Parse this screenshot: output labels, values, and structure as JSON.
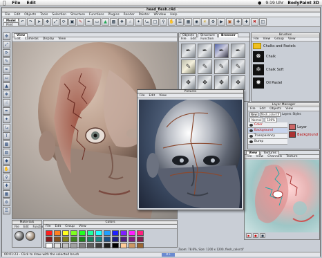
{
  "menubar": {
    "items": [
      "File",
      "Edit"
    ],
    "time": "9:19 Uhr",
    "app": "BodyPaint 3D"
  },
  "main_window": {
    "title": "head_flesh.c4d",
    "menu": [
      "File",
      "Edit",
      "Objects",
      "Tools",
      "Selection",
      "Structure",
      "Functions",
      "Plugins",
      "Render",
      "Painter",
      "Window",
      "Help"
    ],
    "mode_tabs": [
      "Model",
      "Paint"
    ],
    "toolbar_icons": [
      "undo-icon",
      "redo-icon",
      "arrow-icon",
      "move-icon",
      "scale-icon",
      "rotate-icon",
      "select-icon",
      "brush-icon",
      "pen-icon",
      "eraser-icon",
      "fill-icon",
      "gradient-icon",
      "clone-icon",
      "smudge-icon",
      "wand-icon",
      "lasso-icon",
      "rect-select-icon",
      "magnify-icon",
      "hand-icon",
      "layers-icon",
      "grid-icon",
      "camera-icon",
      "light-icon",
      "render-icon",
      "render-view-icon",
      "texture-icon",
      "uv-icon",
      "axis-icon",
      "paint-icon",
      "projection-icon"
    ]
  },
  "viewport": {
    "tab": "View",
    "menu": [
      "Edit",
      "Cameras",
      "Display",
      "View"
    ],
    "tools": [
      "move-icon",
      "scale-icon",
      "rotate-icon",
      "brush-icon",
      "pen-icon",
      "eraser-icon",
      "fill-icon",
      "clone-icon",
      "smudge-icon",
      "eyedrop-icon",
      "wand-icon",
      "lasso-icon",
      "text-icon",
      "stamp-icon",
      "gradient-icon",
      "shape-icon",
      "hand-icon",
      "zoom-icon"
    ]
  },
  "brushes": {
    "tabs": [
      "Objects",
      "Structure",
      "Browser"
    ],
    "menu": [
      "File",
      "Edit",
      "Function"
    ],
    "active_tab": "Browser"
  },
  "brushes_presets": {
    "title": "Brushes",
    "menu": [
      "File",
      "View",
      "Group",
      "View"
    ],
    "items": [
      "Chalks and Pastels",
      "Chalk",
      "Chalk Soft",
      "Oil Pastel"
    ]
  },
  "pictures_window": {
    "title": "Pictures",
    "menu": [
      "File",
      "Edit",
      "View"
    ]
  },
  "layer_manager": {
    "title": "Layer Manager",
    "menu": [
      "File",
      "Edit",
      "Objects",
      "View"
    ],
    "row1": [
      "New",
      "flesh_color.tif",
      "Layers",
      "Styles"
    ],
    "row2": [
      "Normal",
      "100%"
    ],
    "layers": [
      "Color",
      "Background",
      "Transparency",
      "Bump",
      "Layer",
      "Background"
    ]
  },
  "texture_view": {
    "title": "Texture View",
    "menu": [
      "File",
      "View",
      "Channels",
      "Texture",
      "Edit"
    ],
    "tab": "View",
    "tab2": "Textures",
    "status": "Zoom: 78.6%, Size: 1200 x 1200, flesh_color.tif"
  },
  "materials": {
    "title": "Materials",
    "menu": [
      "File",
      "Edit",
      "Function"
    ]
  },
  "colors": {
    "title": "Colors",
    "menu": [
      "File",
      "Edit",
      "Group",
      "View"
    ],
    "swatches": [
      "#ff1f1f",
      "#ff7f1f",
      "#ffff1f",
      "#7fff1f",
      "#1fff1f",
      "#1fff9f",
      "#1fffff",
      "#1f9fff",
      "#1f1fff",
      "#7f1fff",
      "#ff1fff",
      "#ff1f7f",
      "#7f1f1f",
      "#7f4f1f",
      "#7f7f1f",
      "#3f7f1f",
      "#1f7f1f",
      "#1f7f5f",
      "#1f7f7f",
      "#1f4f7f",
      "#1f1f7f",
      "#4f1f7f",
      "#7f1f7f",
      "#7f1f4f",
      "#ffffff",
      "#e0e0e0",
      "#c0c0c0",
      "#a0a0a0",
      "#808080",
      "#606060",
      "#404040",
      "#202020",
      "#000000",
      "#ffcc99",
      "#cc9966",
      "#996633"
    ]
  },
  "statusbar": {
    "text": "00:01:23 - Click to draw with the selected brush",
    "frame": "0 F"
  }
}
